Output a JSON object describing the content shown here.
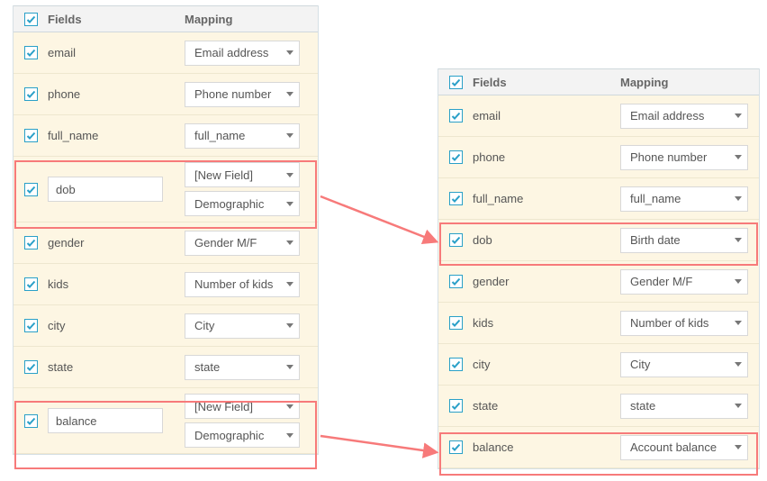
{
  "headers": {
    "fields": "Fields",
    "mapping": "Mapping"
  },
  "left": {
    "rows": [
      {
        "field": "email",
        "input": false,
        "maps": [
          "Email address"
        ]
      },
      {
        "field": "phone",
        "input": false,
        "maps": [
          "Phone number"
        ]
      },
      {
        "field": "full_name",
        "input": false,
        "maps": [
          "full_name"
        ]
      },
      {
        "field": "dob",
        "input": true,
        "maps": [
          "[New Field]",
          "Demographic"
        ]
      },
      {
        "field": "gender",
        "input": false,
        "maps": [
          "Gender M/F"
        ]
      },
      {
        "field": "kids",
        "input": false,
        "maps": [
          "Number of kids"
        ]
      },
      {
        "field": "city",
        "input": false,
        "maps": [
          "City"
        ]
      },
      {
        "field": "state",
        "input": false,
        "maps": [
          "state"
        ]
      },
      {
        "field": "balance",
        "input": true,
        "maps": [
          "[New Field]",
          "Demographic"
        ]
      }
    ]
  },
  "right": {
    "rows": [
      {
        "field": "email",
        "maps": [
          "Email address"
        ]
      },
      {
        "field": "phone",
        "maps": [
          "Phone number"
        ]
      },
      {
        "field": "full_name",
        "maps": [
          "full_name"
        ]
      },
      {
        "field": "dob",
        "maps": [
          "Birth date"
        ]
      },
      {
        "field": "gender",
        "maps": [
          "Gender M/F"
        ]
      },
      {
        "field": "kids",
        "maps": [
          "Number of kids"
        ]
      },
      {
        "field": "city",
        "maps": [
          "City"
        ]
      },
      {
        "field": "state",
        "maps": [
          "state"
        ]
      },
      {
        "field": "balance",
        "maps": [
          "Account balance"
        ]
      }
    ]
  }
}
